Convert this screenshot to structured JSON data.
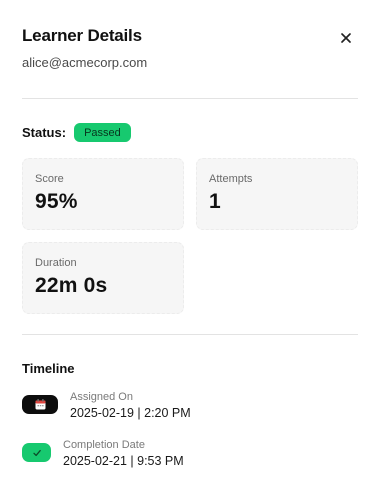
{
  "panel": {
    "title": "Learner Details",
    "email": "alice@acmecorp.com",
    "close_icon": "close-icon"
  },
  "status": {
    "label": "Status:",
    "value": "Passed",
    "color": "#17c96f"
  },
  "stats": [
    {
      "label": "Score",
      "value": "95%"
    },
    {
      "label": "Attempts",
      "value": "1"
    },
    {
      "label": "Duration",
      "value": "22m 0s"
    }
  ],
  "timeline": {
    "title": "Timeline",
    "items": [
      {
        "icon": "calendar-icon",
        "label": "Assigned On",
        "value": "2025-02-19 | 2:20 PM"
      },
      {
        "icon": "check-icon",
        "label": "Completion Date",
        "value": "2025-02-21 | 9:53 PM"
      }
    ]
  }
}
